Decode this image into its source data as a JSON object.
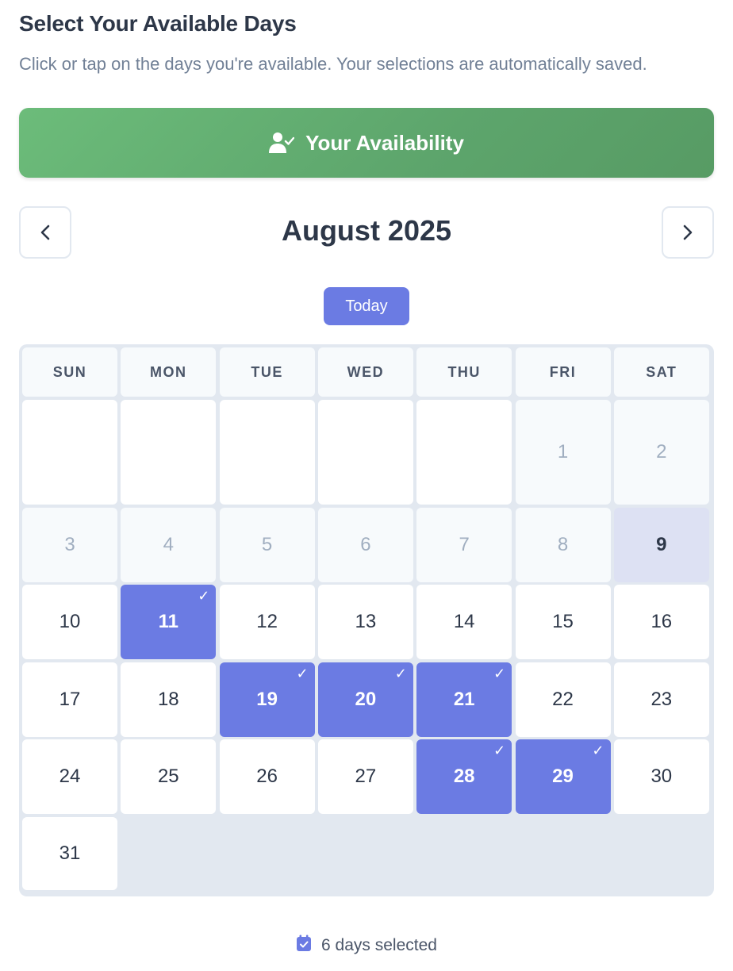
{
  "title": "Select Your Available Days",
  "subtitle": "Click or tap on the days you're available. Your selections are automatically saved.",
  "banner": {
    "label": "Your Availability",
    "icon": "user-check-icon"
  },
  "calendar": {
    "month_label": "August 2025",
    "prev_icon": "chevron-left-icon",
    "next_icon": "chevron-right-icon",
    "today_label": "Today",
    "weekdays": [
      "SUN",
      "MON",
      "TUE",
      "WED",
      "THU",
      "FRI",
      "SAT"
    ],
    "first_weekday_index": 5,
    "days_in_month": 31,
    "past_days": [
      1,
      2,
      3,
      4,
      5,
      6,
      7,
      8
    ],
    "today": 9,
    "selected_days": [
      11,
      19,
      20,
      21,
      28,
      29
    ],
    "check_glyph": "✓"
  },
  "footer": {
    "icon": "calendar-check-icon",
    "text": "6 days selected"
  },
  "colors": {
    "accent": "#6b7be3",
    "banner": "#5da56c",
    "today_bg": "#dde1f3",
    "grid_bg": "#e2e8f0"
  }
}
